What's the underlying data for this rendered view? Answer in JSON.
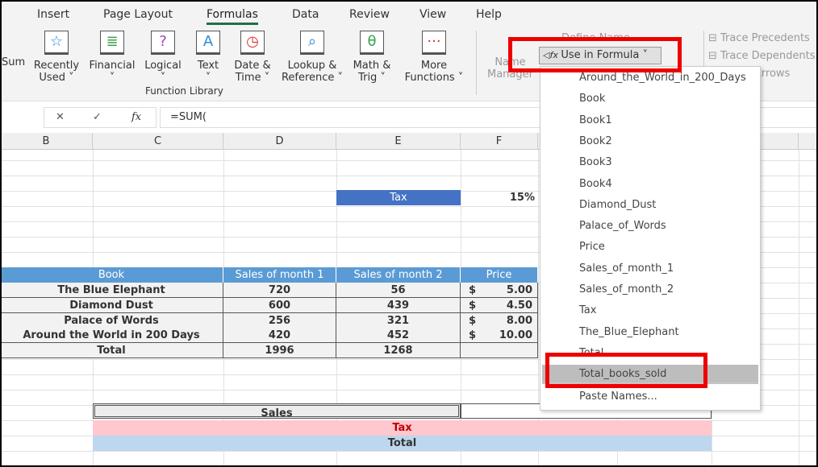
{
  "tabs": [
    "Insert",
    "Page Layout",
    "Formulas",
    "Data",
    "Review",
    "View",
    "Help"
  ],
  "active_tab": "Formulas",
  "ribbon": {
    "autosum_partial": "Sum",
    "buttons": [
      {
        "l1": "Recently",
        "l2": "Used ˅",
        "icon": "star-icon",
        "glyph": "☆",
        "color": "#2e8bd6"
      },
      {
        "l1": "Financial",
        "l2": "˅",
        "icon": "coins-icon",
        "glyph": "≣",
        "color": "#3aa14b"
      },
      {
        "l1": "Logical",
        "l2": "˅",
        "icon": "question-icon",
        "glyph": "?",
        "color": "#a040c0"
      },
      {
        "l1": "Text",
        "l2": "˅",
        "icon": "text-a-icon",
        "glyph": "A",
        "color": "#2e8bd6"
      },
      {
        "l1": "Date &",
        "l2": "Time ˅",
        "icon": "clock-icon",
        "glyph": "◷",
        "color": "#e03030"
      },
      {
        "l1": "Lookup &",
        "l2": "Reference ˅",
        "icon": "magnifier-icon",
        "glyph": "⌕",
        "color": "#2e8bd6"
      },
      {
        "l1": "Math &",
        "l2": "Trig ˅",
        "icon": "theta-icon",
        "glyph": "θ",
        "color": "#3aa14b"
      },
      {
        "l1": "More",
        "l2": "Functions ˅",
        "icon": "more-icon",
        "glyph": "···",
        "color": "#e03030"
      }
    ],
    "group_label": "Function Library",
    "name_manager": [
      "Name",
      "Manager"
    ],
    "define_name": "Define Name",
    "use_in_formula": "Use in Formula ˅",
    "trace_precedents": "Trace Precedents",
    "trace_dependents": "Trace Dependents",
    "remove_arrows": "Remove Arrows"
  },
  "formula_bar": {
    "cancel": "✕",
    "enter": "✓",
    "fx": "fx",
    "value": "=SUM("
  },
  "columns": [
    "B",
    "C",
    "D",
    "E",
    "F"
  ],
  "tax_label": "Tax",
  "tax_value": "15%",
  "table": {
    "headers": [
      "Book",
      "Sales of month 1",
      "Sales of month 2",
      "Price"
    ],
    "rows": [
      [
        "The Blue Elephant",
        "720",
        "56",
        "$",
        "5.00"
      ],
      [
        "Diamond Dust",
        "600",
        "439",
        "$",
        "4.50"
      ],
      [
        "Palace of Words",
        "256",
        "321",
        "$",
        "8.00"
      ],
      [
        "Around the World in 200 Days",
        "420",
        "452",
        "$",
        "10.00"
      ],
      [
        "Total",
        "1996",
        "1268",
        "",
        ""
      ]
    ]
  },
  "summary": {
    "sales": "Sales",
    "tax": "Tax",
    "total": "Total"
  },
  "menu_items": [
    "Around_the_World_in_200_Days",
    "Book",
    "Book1",
    "Book2",
    "Book3",
    "Book4",
    "Diamond_Dust",
    "Palace_of_Words",
    "Price",
    "Sales_of_month_1",
    "Sales_of_month_2",
    "Tax",
    "The_Blue_Elephant",
    "Total",
    "Total_books_sold",
    "Paste Names..."
  ],
  "highlighted_item": "Total_books_sold",
  "colors": {
    "header_blue": "#5b9bd5",
    "tax_pink": "#ffc7ce",
    "total_blue": "#bdd7ee",
    "highlight_red": "#e00000",
    "accent_green": "#1e7145"
  }
}
